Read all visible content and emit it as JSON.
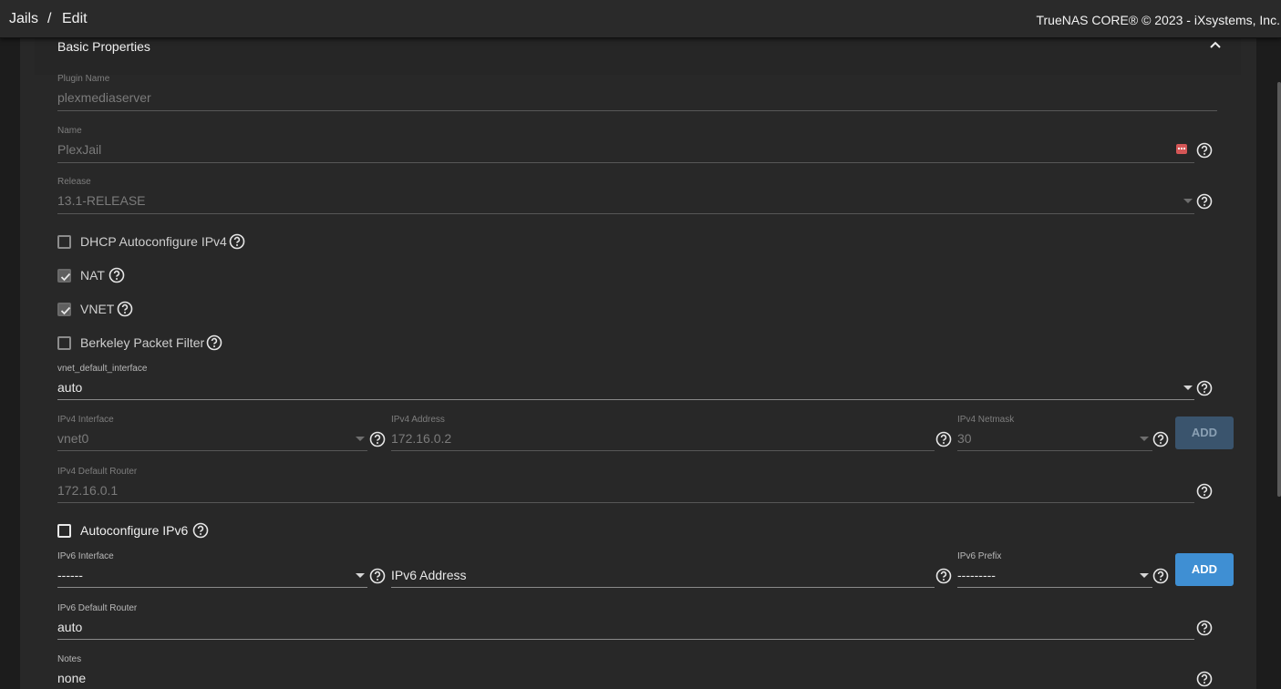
{
  "header": {
    "breadcrumb_root": "Jails",
    "breadcrumb_sep": "/",
    "breadcrumb_current": "Edit",
    "copyright": "TrueNAS CORE® © 2023 - iXsystems, Inc."
  },
  "section": {
    "title": "Basic Properties"
  },
  "fields": {
    "plugin_name": {
      "label": "Plugin Name",
      "value": "plexmediaserver"
    },
    "name": {
      "label": "Name",
      "value": "PlexJail"
    },
    "release": {
      "label": "Release",
      "value": "13.1-RELEASE"
    },
    "vnet_default_interface": {
      "label": "vnet_default_interface",
      "value": "auto"
    },
    "ipv4_interface": {
      "label": "IPv4 Interface",
      "value": "vnet0"
    },
    "ipv4_address": {
      "label": "IPv4 Address",
      "value": "172.16.0.2"
    },
    "ipv4_netmask": {
      "label": "IPv4 Netmask",
      "value": "30"
    },
    "ipv4_default_router": {
      "label": "IPv4 Default Router",
      "value": "172.16.0.1"
    },
    "ipv6_interface": {
      "label": "IPv6 Interface",
      "value": "------"
    },
    "ipv6_address": {
      "placeholder": "IPv6 Address"
    },
    "ipv6_prefix": {
      "label": "IPv6 Prefix",
      "value": "---------"
    },
    "ipv6_default_router": {
      "label": "IPv6 Default Router",
      "value": "auto"
    },
    "notes": {
      "label": "Notes",
      "value": "none"
    }
  },
  "checkboxes": {
    "dhcp": {
      "label": "DHCP Autoconfigure IPv4",
      "checked": false
    },
    "nat": {
      "label": "NAT",
      "checked": true
    },
    "vnet": {
      "label": "VNET",
      "checked": true
    },
    "bpf": {
      "label": "Berkeley Packet Filter",
      "checked": false
    },
    "autoconf_ipv6": {
      "label": "Autoconfigure IPv6",
      "checked": false
    }
  },
  "buttons": {
    "ipv4_add": "ADD",
    "ipv6_add": "ADD"
  },
  "icons": {
    "help": "help-circle-icon",
    "collapse": "chevron-up-icon",
    "dropdown": "caret-down-icon",
    "keyboard": "keyboard-badge-icon"
  },
  "colors": {
    "primary": "#3f8fd3",
    "primary_disabled": "#3a546d",
    "background": "#282828",
    "topbar": "#2a2a2a"
  }
}
